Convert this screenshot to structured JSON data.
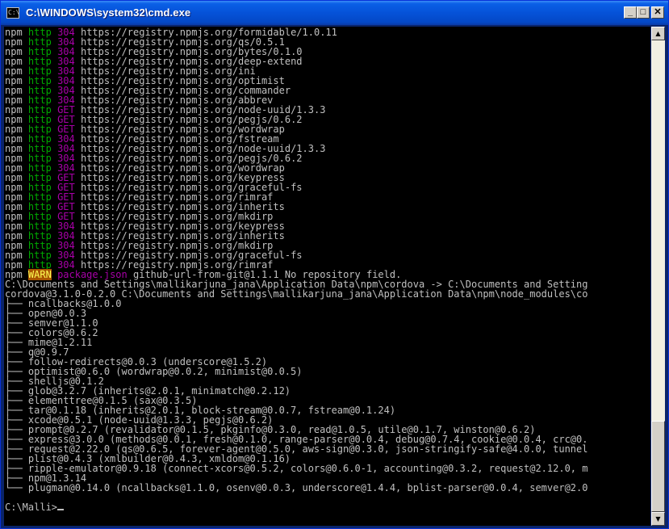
{
  "window": {
    "title": "C:\\WINDOWS\\system32\\cmd.exe",
    "icon_text": "C:\\",
    "buttons": {
      "minimize": "_",
      "maximize": "□",
      "close": "✕"
    }
  },
  "colors": {
    "http": "#00a800",
    "status": "#a800a8",
    "warn_fg": "#ffff54",
    "warn_bg": "#a85400",
    "text": "#c0c0c0",
    "background": "#000000"
  },
  "requests": [
    {
      "cmd": "npm",
      "proto": "http",
      "status": "304",
      "url": "https://registry.npmjs.org/formidable/1.0.11"
    },
    {
      "cmd": "npm",
      "proto": "http",
      "status": "304",
      "url": "https://registry.npmjs.org/qs/0.5.1"
    },
    {
      "cmd": "npm",
      "proto": "http",
      "status": "304",
      "url": "https://registry.npmjs.org/bytes/0.1.0"
    },
    {
      "cmd": "npm",
      "proto": "http",
      "status": "304",
      "url": "https://registry.npmjs.org/deep-extend"
    },
    {
      "cmd": "npm",
      "proto": "http",
      "status": "304",
      "url": "https://registry.npmjs.org/ini"
    },
    {
      "cmd": "npm",
      "proto": "http",
      "status": "304",
      "url": "https://registry.npmjs.org/optimist"
    },
    {
      "cmd": "npm",
      "proto": "http",
      "status": "304",
      "url": "https://registry.npmjs.org/commander"
    },
    {
      "cmd": "npm",
      "proto": "http",
      "status": "304",
      "url": "https://registry.npmjs.org/abbrev"
    },
    {
      "cmd": "npm",
      "proto": "http",
      "status": "GET",
      "url": "https://registry.npmjs.org/node-uuid/1.3.3"
    },
    {
      "cmd": "npm",
      "proto": "http",
      "status": "GET",
      "url": "https://registry.npmjs.org/pegjs/0.6.2"
    },
    {
      "cmd": "npm",
      "proto": "http",
      "status": "GET",
      "url": "https://registry.npmjs.org/wordwrap"
    },
    {
      "cmd": "npm",
      "proto": "http",
      "status": "304",
      "url": "https://registry.npmjs.org/fstream"
    },
    {
      "cmd": "npm",
      "proto": "http",
      "status": "304",
      "url": "https://registry.npmjs.org/node-uuid/1.3.3"
    },
    {
      "cmd": "npm",
      "proto": "http",
      "status": "304",
      "url": "https://registry.npmjs.org/pegjs/0.6.2"
    },
    {
      "cmd": "npm",
      "proto": "http",
      "status": "304",
      "url": "https://registry.npmjs.org/wordwrap"
    },
    {
      "cmd": "npm",
      "proto": "http",
      "status": "GET",
      "url": "https://registry.npmjs.org/keypress"
    },
    {
      "cmd": "npm",
      "proto": "http",
      "status": "GET",
      "url": "https://registry.npmjs.org/graceful-fs"
    },
    {
      "cmd": "npm",
      "proto": "http",
      "status": "GET",
      "url": "https://registry.npmjs.org/rimraf"
    },
    {
      "cmd": "npm",
      "proto": "http",
      "status": "GET",
      "url": "https://registry.npmjs.org/inherits"
    },
    {
      "cmd": "npm",
      "proto": "http",
      "status": "GET",
      "url": "https://registry.npmjs.org/mkdirp"
    },
    {
      "cmd": "npm",
      "proto": "http",
      "status": "304",
      "url": "https://registry.npmjs.org/keypress"
    },
    {
      "cmd": "npm",
      "proto": "http",
      "status": "304",
      "url": "https://registry.npmjs.org/inherits"
    },
    {
      "cmd": "npm",
      "proto": "http",
      "status": "304",
      "url": "https://registry.npmjs.org/mkdirp"
    },
    {
      "cmd": "npm",
      "proto": "http",
      "status": "304",
      "url": "https://registry.npmjs.org/graceful-fs"
    },
    {
      "cmd": "npm",
      "proto": "http",
      "status": "304",
      "url": "https://registry.npmjs.org/rimraf"
    }
  ],
  "warn": {
    "cmd": "npm",
    "level": "WARN",
    "file": "package.json",
    "message": "github-url-from-git@1.1.1 No repository field."
  },
  "install": {
    "link_line": "C:\\Documents and Settings\\mallikarjuna_jana\\Application Data\\npm\\cordova -> C:\\Documents and Setting",
    "pkg_line": "cordova@3.1.0-0.2.0 C:\\Documents and Settings\\mallikarjuna_jana\\Application Data\\npm\\node_modules\\co"
  },
  "tree": [
    {
      "prefix": "├── ",
      "text": "ncallbacks@1.0.0"
    },
    {
      "prefix": "├── ",
      "text": "open@0.0.3"
    },
    {
      "prefix": "├── ",
      "text": "semver@1.1.0"
    },
    {
      "prefix": "├── ",
      "text": "colors@0.6.2"
    },
    {
      "prefix": "├── ",
      "text": "mime@1.2.11"
    },
    {
      "prefix": "├── ",
      "text": "q@0.9.7"
    },
    {
      "prefix": "├── ",
      "text": "follow-redirects@0.0.3 (underscore@1.5.2)"
    },
    {
      "prefix": "├── ",
      "text": "optimist@0.6.0 (wordwrap@0.0.2, minimist@0.0.5)"
    },
    {
      "prefix": "├── ",
      "text": "shelljs@0.1.2"
    },
    {
      "prefix": "├── ",
      "text": "glob@3.2.7 (inherits@2.0.1, minimatch@0.2.12)"
    },
    {
      "prefix": "├── ",
      "text": "elementtree@0.1.5 (sax@0.3.5)"
    },
    {
      "prefix": "├── ",
      "text": "tar@0.1.18 (inherits@2.0.1, block-stream@0.0.7, fstream@0.1.24)"
    },
    {
      "prefix": "├── ",
      "text": "xcode@0.5.1 (node-uuid@1.3.3, pegjs@0.6.2)"
    },
    {
      "prefix": "├── ",
      "text": "prompt@0.2.7 (revalidator@0.1.5, pkginfo@0.3.0, read@1.0.5, utile@0.1.7, winston@0.6.2)"
    },
    {
      "prefix": "├── ",
      "text": "express@3.0.0 (methods@0.0.1, fresh@0.1.0, range-parser@0.0.4, debug@0.7.4, cookie@0.0.4, crc@0."
    },
    {
      "prefix": "├── ",
      "text": "request@2.22.0 (qs@0.6.5, forever-agent@0.5.0, aws-sign@0.3.0, json-stringify-safe@4.0.0, tunnel"
    },
    {
      "prefix": "├── ",
      "text": "plist@0.4.3 (xmlbuilder@0.4.3, xmldom@0.1.16)"
    },
    {
      "prefix": "├── ",
      "text": "ripple-emulator@0.9.18 (connect-xcors@0.5.2, colors@0.6.0-1, accounting@0.3.2, request@2.12.0, m"
    },
    {
      "prefix": "├── ",
      "text": "npm@1.3.14"
    },
    {
      "prefix": "└── ",
      "text": "plugman@0.14.0 (ncallbacks@1.1.0, osenv@0.0.3, underscore@1.4.4, bplist-parser@0.0.4, semver@2.0"
    }
  ],
  "prompt": "C:\\Malli>"
}
